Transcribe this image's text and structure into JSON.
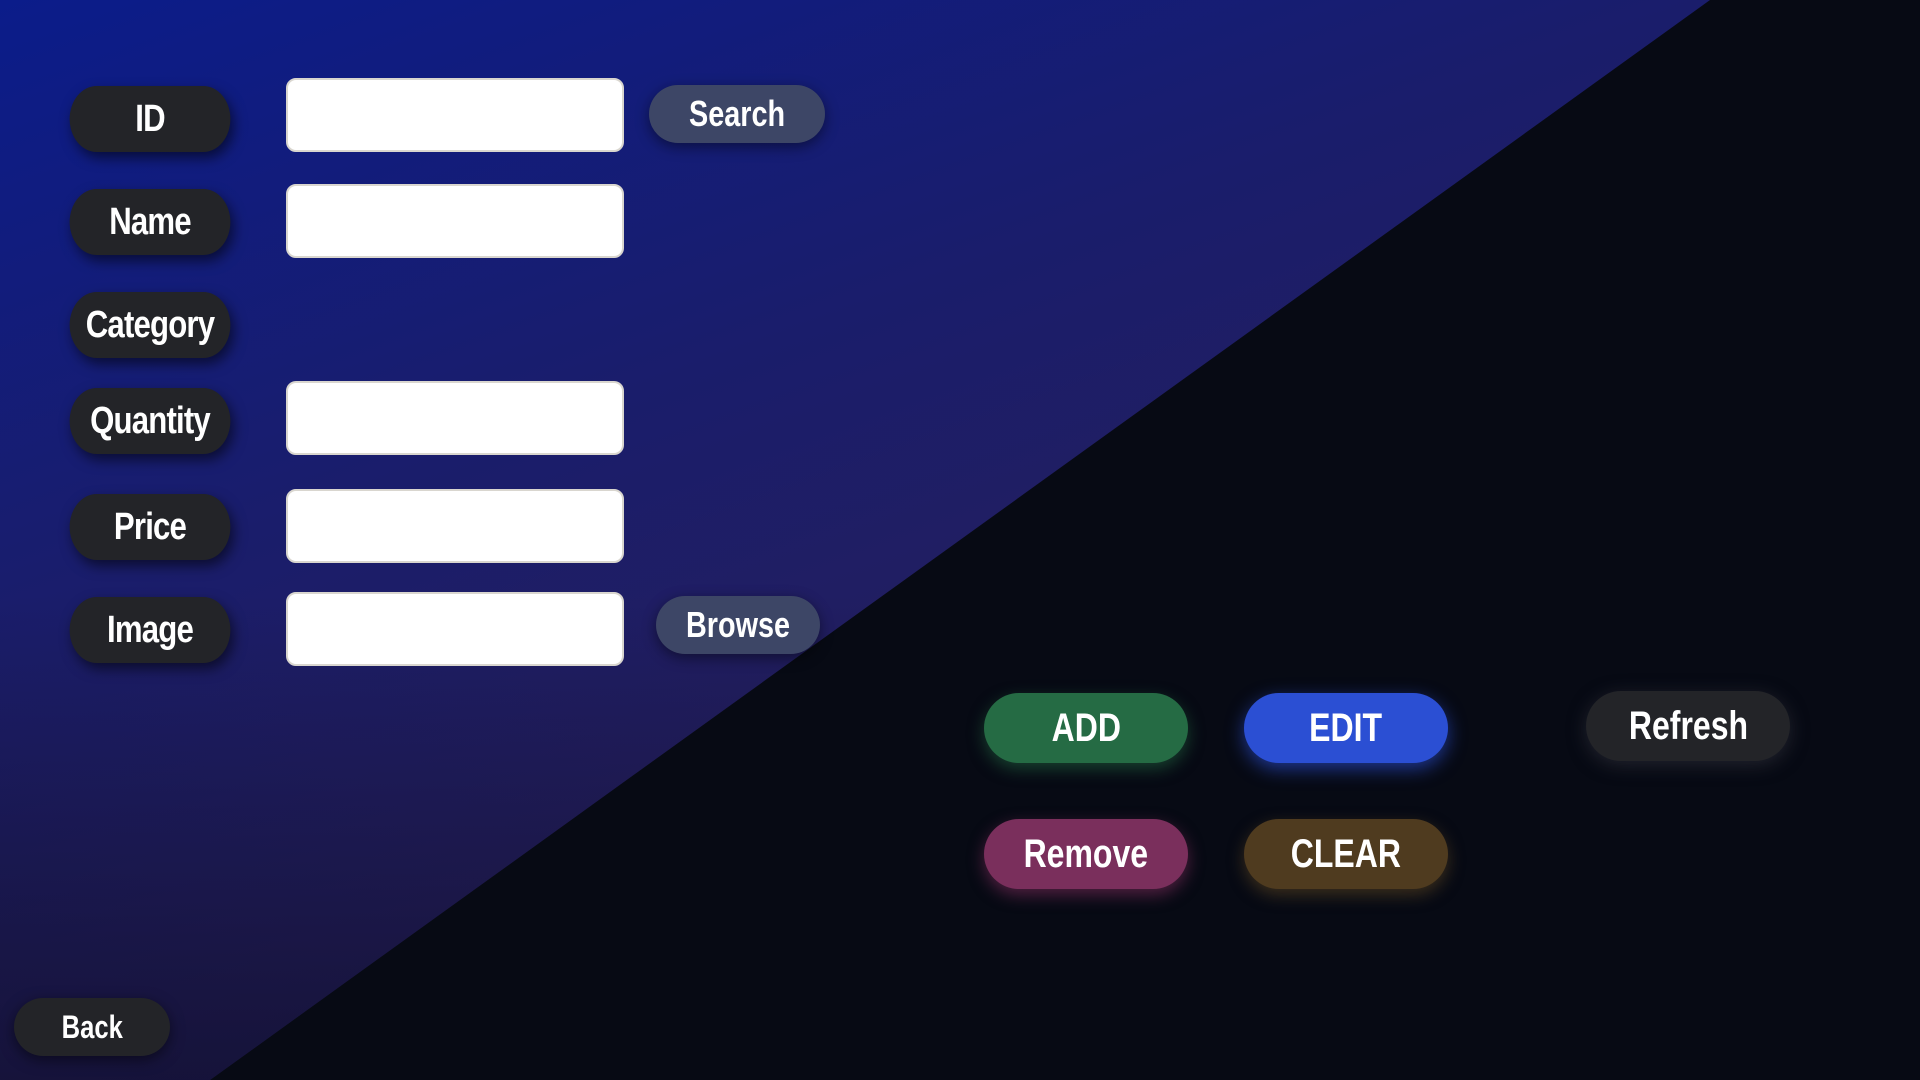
{
  "form": {
    "fields": [
      {
        "label": "ID",
        "value": "",
        "placeholder": ""
      },
      {
        "label": "Name",
        "value": "",
        "placeholder": ""
      },
      {
        "label": "Category"
      },
      {
        "label": "Quantity",
        "value": "",
        "placeholder": ""
      },
      {
        "label": "Price",
        "value": "",
        "placeholder": ""
      },
      {
        "label": "Image",
        "value": "",
        "placeholder": ""
      }
    ],
    "search_label": "Search",
    "browse_label": "Browse"
  },
  "actions": {
    "add_label": "ADD",
    "edit_label": "EDIT",
    "refresh_label": "Refresh",
    "remove_label": "Remove",
    "clear_label": "CLEAR"
  },
  "nav": {
    "back_label": "Back"
  },
  "colors": {
    "add": "#256b44",
    "edit": "#2b4fd3",
    "remove": "#7a2f5c",
    "clear": "#4f3b1f",
    "neutral": "#232428",
    "secondary": "#3d4666"
  }
}
